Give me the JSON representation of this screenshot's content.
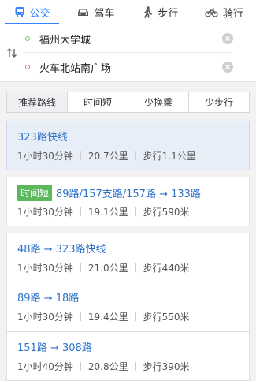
{
  "modes": [
    {
      "label": "公交",
      "icon": "bus-icon",
      "active": true
    },
    {
      "label": "驾车",
      "icon": "car-icon",
      "active": false
    },
    {
      "label": "步行",
      "icon": "walk-icon",
      "active": false
    },
    {
      "label": "骑行",
      "icon": "bike-icon",
      "active": false
    }
  ],
  "route": {
    "start": "福州大学城",
    "end": "火车北站南广场"
  },
  "sort_options": [
    "推荐路线",
    "时间短",
    "少换乘",
    "少步行"
  ],
  "results": [
    {
      "title": "323路快线",
      "tag": "",
      "duration": "1小时30分钟",
      "distance": "20.7公里",
      "walk": "步行1.1公里"
    },
    {
      "title": "89路/157支路/157路 → 133路",
      "tag": "时间短",
      "duration": "1小时30分钟",
      "distance": "19.1公里",
      "walk": "步行590米"
    },
    {
      "title": "48路 → 323路快线",
      "tag": "",
      "duration": "1小时30分钟",
      "distance": "21.0公里",
      "walk": "步行440米"
    },
    {
      "title": "89路 → 18路",
      "tag": "",
      "duration": "1小时30分钟",
      "distance": "19.4公里",
      "walk": "步行550米"
    },
    {
      "title": "151路 → 308路",
      "tag": "",
      "duration": "1小时40分钟",
      "distance": "20.8公里",
      "walk": "步行390米"
    }
  ],
  "colors": {
    "accent": "#3385ff",
    "link": "#2f73c9",
    "tag": "#5cb85c",
    "selected_card": "#e8eef8"
  }
}
